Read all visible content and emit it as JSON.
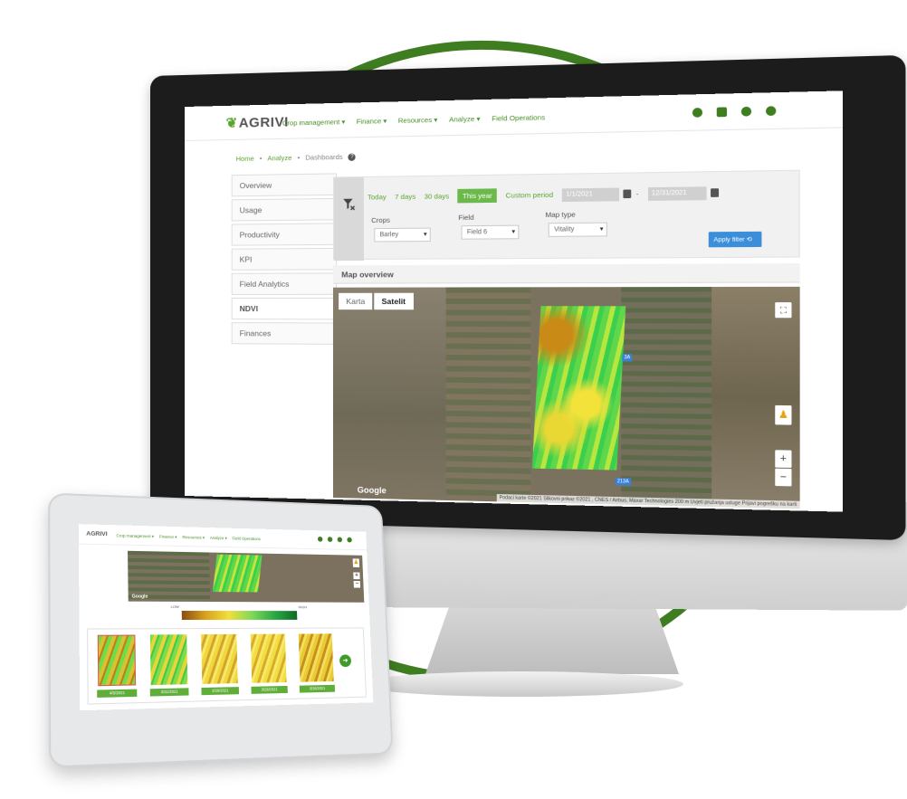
{
  "monitor": {
    "brand": "AGRIVI",
    "menu": [
      "Crop management ▾",
      "Finance ▾",
      "Resources ▾",
      "Analyze ▾",
      "Field Operations"
    ],
    "breadcrumb": [
      "Home",
      "Analyze",
      "Dashboards"
    ],
    "sidebar": [
      {
        "label": "Overview",
        "active": false
      },
      {
        "label": "Usage",
        "active": false
      },
      {
        "label": "Productivity",
        "active": false
      },
      {
        "label": "KPI",
        "active": false
      },
      {
        "label": "Field Analytics",
        "active": false
      },
      {
        "label": "NDVI",
        "active": true
      },
      {
        "label": "Finances",
        "active": false
      }
    ],
    "filters": {
      "periods": [
        "Today",
        "7 days",
        "30 days",
        "This year",
        "Custom period"
      ],
      "active_period": "This year",
      "date_from": "1/1/2021",
      "date_separator": "-",
      "date_to": "12/31/2021",
      "crops_label": "Crops",
      "crops_value": "Barley",
      "field_label": "Field",
      "field_value": "Field 6",
      "maptype_label": "Map type",
      "maptype_value": "Vitality",
      "apply_label": "Apply filter ⟲"
    },
    "map_section_title": "Map overview",
    "map": {
      "tabs": [
        "Karta",
        "Satelit"
      ],
      "active_tab": "Satelit",
      "zoom_in": "+",
      "zoom_out": "−",
      "google_logo": "Google",
      "attribution": "Podaci karte ©2021 Slikovni prikaz ©2021 , CNES / Airbus, Maxar Technologies   200 m   Uvjeti pružanja usluge   Prijavi pogrešku na karti",
      "road_badges": [
        "3A",
        "213A"
      ]
    }
  },
  "tablet": {
    "brand": "AGRIVI",
    "menu": [
      "Crop management ▾",
      "Finance ▾",
      "Resources ▾",
      "Analyze ▾",
      "Field Operations"
    ],
    "legend_low": "LOW",
    "legend_high": "HIGH",
    "map_google": "Google",
    "thumbnails": [
      "4/5/2021",
      "3/31/2021",
      "3/28/2021",
      "3/28/2021",
      "3/26/2021"
    ],
    "next_icon": "arrow-right-icon"
  },
  "colors": {
    "brand_green": "#5aa532",
    "loop_green": "#3f7d21",
    "button_blue": "#3b8ed9"
  }
}
